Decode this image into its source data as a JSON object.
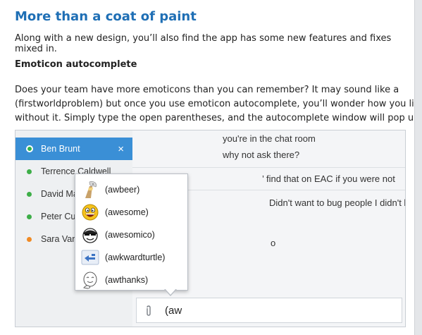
{
  "article": {
    "title": "More than a coat of paint",
    "intro": "Along with a new design, you’ll also find the app has some new features and fixes mixed in.",
    "section_heading": "Emoticon autocomplete",
    "body_lines": [
      "Does your team have more emoticons than you can remember? It may sound like a",
      "(firstworldproblem) but once you use emoticon autocomplete, you’ll wonder how you lived",
      "without it. Simply type the open parentheses, and the autocomplete window will pop up."
    ]
  },
  "app": {
    "sidebar": {
      "items": [
        {
          "label": "Ben Brunt",
          "status": "online",
          "active": true,
          "close": "×"
        },
        {
          "label": "Terrence Caldwell",
          "status": "online"
        },
        {
          "label": "David Ma",
          "status": "online"
        },
        {
          "label": "Peter Cu",
          "status": "online"
        },
        {
          "label": "Sara Van",
          "status": "away"
        }
      ]
    },
    "chat": {
      "lines": [
        "you're in the chat room",
        "why not ask there?",
        "’ find that on EAC if you were not",
        "Didn't want to bug people I didn't l",
        "o"
      ]
    },
    "composer": {
      "attach_icon": "paperclip-icon",
      "value": "(aw"
    },
    "autocomplete": {
      "items": [
        {
          "code": "(awbeer)",
          "icon": "beer-icon"
        },
        {
          "code": "(awesome)",
          "icon": "awesome-face-icon"
        },
        {
          "code": "(awesomico)",
          "icon": "awesomico-face-icon"
        },
        {
          "code": "(awkwardturtle)",
          "icon": "awkward-turtle-icon"
        },
        {
          "code": "(awthanks)",
          "icon": "awthanks-face-icon"
        }
      ]
    }
  },
  "colors": {
    "heading": "#1f6fb5",
    "active_contact": "#3a8fd6",
    "online": "#3dae48",
    "away": "#f08a24"
  }
}
